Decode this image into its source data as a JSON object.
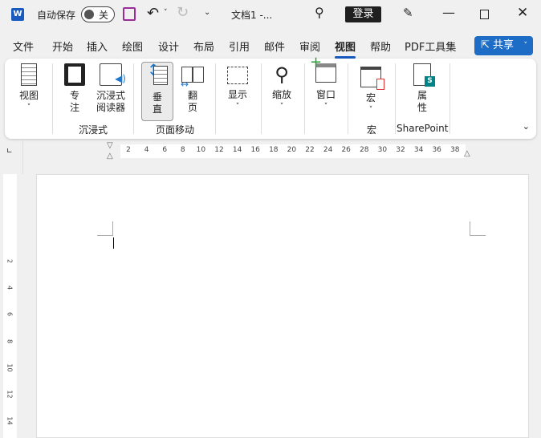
{
  "titlebar": {
    "autosave_label": "自动保存",
    "autosave_state": "关",
    "doc_title": "文档1  -...",
    "login": "登录"
  },
  "tabs": [
    {
      "label": "文件"
    },
    {
      "label": "开始"
    },
    {
      "label": "插入"
    },
    {
      "label": "绘图"
    },
    {
      "label": "设计"
    },
    {
      "label": "布局"
    },
    {
      "label": "引用"
    },
    {
      "label": "邮件"
    },
    {
      "label": "审阅"
    },
    {
      "label": "视图",
      "active": true
    },
    {
      "label": "帮助"
    },
    {
      "label": "PDF工具集"
    }
  ],
  "share": "共享",
  "ribbon": {
    "view": "视图",
    "focus": [
      "专",
      "注"
    ],
    "reader": [
      "沉浸式",
      "阅读器"
    ],
    "group_immersive": "沉浸式",
    "vertical": [
      "垂",
      "直"
    ],
    "flip": [
      "翻",
      "页"
    ],
    "group_page": "页面移动",
    "show": "显示",
    "zoom": "缩放",
    "window": "窗口",
    "macro": "宏",
    "group_macro": "宏",
    "props": [
      "属",
      "性"
    ],
    "group_sp": "SharePoint"
  },
  "ruler": {
    "h": [
      "2",
      "4",
      "6",
      "8",
      "10",
      "12",
      "14",
      "16",
      "18",
      "20",
      "22",
      "24",
      "26",
      "28",
      "30",
      "32",
      "34",
      "36",
      "38"
    ],
    "v": [
      "2",
      "4",
      "6",
      "8",
      "10",
      "12",
      "14"
    ]
  },
  "colors": {
    "accent": "#185abd",
    "share": "#1d6dc7"
  }
}
